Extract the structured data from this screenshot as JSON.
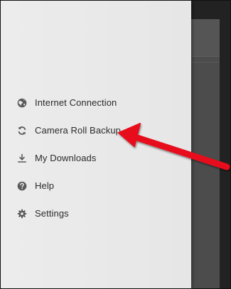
{
  "menu": {
    "items": [
      {
        "label": "Internet Connection",
        "icon": "globe-icon"
      },
      {
        "label": "Camera Roll Backup",
        "icon": "sync-icon"
      },
      {
        "label": "My Downloads",
        "icon": "download-icon"
      },
      {
        "label": "Help",
        "icon": "help-icon"
      },
      {
        "label": "Settings",
        "icon": "gear-icon"
      }
    ]
  },
  "colors": {
    "drawer_background": "#e8e8e8",
    "icon": "#5a5a5a",
    "text": "#2b2b2b",
    "annotation_arrow": "#e8101a"
  }
}
